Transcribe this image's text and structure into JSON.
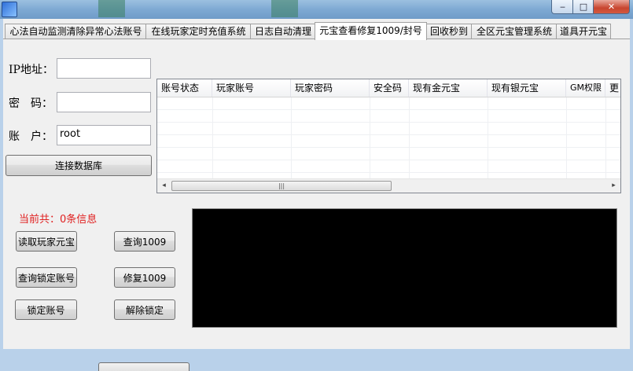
{
  "window": {
    "minimize_glyph": "‒",
    "maximize_glyph": "□",
    "close_glyph": "✕"
  },
  "tabs": [
    {
      "label": "心法自动监测清除异常心法账号"
    },
    {
      "label": "在线玩家定时充值系统"
    },
    {
      "label": "日志自动清理"
    },
    {
      "label": "元宝查看修复1009/封号"
    },
    {
      "label": "回收秒到"
    },
    {
      "label": "全区元宝管理系统"
    },
    {
      "label": "道具开元宝"
    }
  ],
  "active_tab": "元宝查看修复1009/封号",
  "form": {
    "ip_label": "IP地址：",
    "ip_value": "",
    "password_label": "密　码：",
    "password_value": "",
    "account_label": "账　户：",
    "account_value": "root",
    "connect_button": "连接数据库"
  },
  "grid": {
    "columns": [
      "账号状态",
      "玩家账号",
      "玩家密码",
      "安全码",
      "现有金元宝",
      "现有银元宝",
      "GM权限",
      "更"
    ],
    "scroll_left": "◂",
    "scroll_right": "▸",
    "thumb_grip": "|||"
  },
  "status_text": "当前共：0条信息",
  "buttons": {
    "read_yuanbao": "读取玩家元宝",
    "query_1009": "查询1009",
    "query_locked": "查询锁定账号",
    "repair_1009": "修复1009",
    "lock_account": "锁定账号",
    "unlock": "解除锁定"
  },
  "colors": {
    "status_red": "#e02020",
    "console_bg": "#000000"
  }
}
